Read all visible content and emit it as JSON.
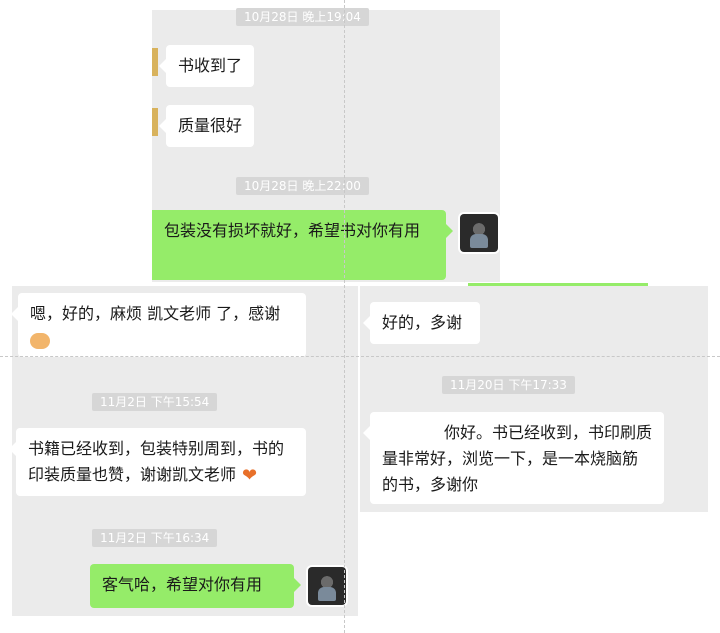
{
  "chat_top": {
    "ts1": "10月28日 晚上19:04",
    "msg1": "书收到了",
    "msg2": "质量很好",
    "ts2": "10月28日 晚上22:00",
    "reply": "包装没有损坏就好，希望书对你有用"
  },
  "chat_left": {
    "msg1": "嗯，好的，麻烦 凯文老师 了，感谢",
    "ts1": "11月2日 下午15:54",
    "msg2": "书籍已经收到，包装特别周到，书的印装质量也赞，谢谢凯文老师",
    "ts2": "11月2日 下午16:34",
    "reply": "客气哈，希望对你有用"
  },
  "chat_right": {
    "msg1": "好的，多谢",
    "ts1": "11月20日 下午17:33",
    "msg2": "你好。书已经收到，书印刷质量非常好，浏览一下，是一本烧脑筋的书，多谢你"
  },
  "icons": {
    "handshake": "handshake-emoji-icon",
    "heart": "heart-emoji-icon"
  },
  "colors": {
    "bubble_green": "#95ec69",
    "panel_gray": "#ebebeb",
    "timestamp_bg": "#d6d6d6"
  }
}
